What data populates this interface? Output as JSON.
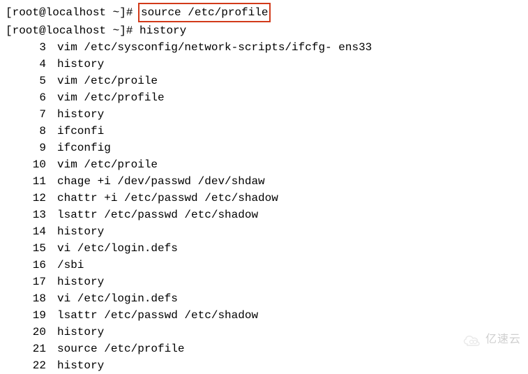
{
  "prompt1": {
    "prefix": "[root@localhost ~]# ",
    "cmd": "source /etc/profile"
  },
  "prompt2": {
    "prefix": "[root@localhost ~]# ",
    "cmd": "history"
  },
  "history": [
    {
      "n": "3",
      "c": "vim /etc/sysconfig/network-scripts/ifcfg- ens33"
    },
    {
      "n": "4",
      "c": "history"
    },
    {
      "n": "5",
      "c": "vim /etc/proile"
    },
    {
      "n": "6",
      "c": "vim /etc/profile"
    },
    {
      "n": "7",
      "c": "history"
    },
    {
      "n": "8",
      "c": "ifconfi"
    },
    {
      "n": "9",
      "c": "ifconfig"
    },
    {
      "n": "10",
      "c": "vim /etc/proile"
    },
    {
      "n": "11",
      "c": "chage +i /dev/passwd /dev/shdaw"
    },
    {
      "n": "12",
      "c": "chattr +i /etc/passwd /etc/shadow"
    },
    {
      "n": "13",
      "c": "lsattr /etc/passwd /etc/shadow"
    },
    {
      "n": "14",
      "c": "history"
    },
    {
      "n": "15",
      "c": "vi /etc/login.defs"
    },
    {
      "n": "16",
      "c": "/sbi"
    },
    {
      "n": "17",
      "c": "history"
    },
    {
      "n": "18",
      "c": "vi /etc/login.defs"
    },
    {
      "n": "19",
      "c": "lsattr /etc/passwd /etc/shadow"
    },
    {
      "n": "20",
      "c": "history"
    },
    {
      "n": "21",
      "c": "source /etc/profile"
    },
    {
      "n": "22",
      "c": "history"
    }
  ],
  "watermark": "亿速云"
}
